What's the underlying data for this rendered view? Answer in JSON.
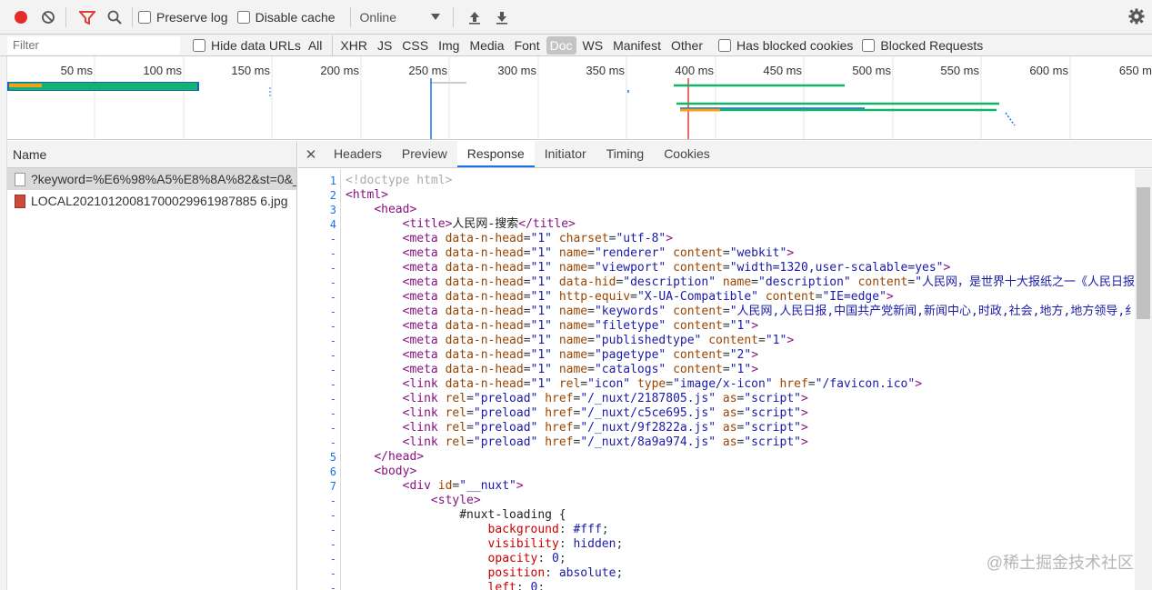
{
  "toolbar": {
    "record_icon": "record-icon",
    "clear_icon": "clear-icon",
    "filter_icon": "filter-icon",
    "search_icon": "search-icon",
    "preserve_log": "Preserve log",
    "disable_cache": "Disable cache",
    "throttle_value": "Online",
    "colors": {
      "record": "#e32d2d",
      "filter": "#e53935"
    }
  },
  "filterbar": {
    "placeholder": "Filter",
    "hide_data_urls": "Hide data URLs",
    "types": [
      "All",
      "XHR",
      "JS",
      "CSS",
      "Img",
      "Media",
      "Font",
      "Doc",
      "WS",
      "Manifest",
      "Other"
    ],
    "active_type": "Doc",
    "has_blocked_cookies": "Has blocked cookies",
    "blocked_requests": "Blocked Requests"
  },
  "overview": {
    "ticks": [
      "50 ms",
      "100 ms",
      "150 ms",
      "200 ms",
      "250 ms",
      "300 ms",
      "350 ms",
      "400 ms",
      "450 ms",
      "500 ms",
      "550 ms",
      "600 ms",
      "650 m"
    ]
  },
  "requests": {
    "header": "Name",
    "items": [
      {
        "name": "?keyword=%E6%98%A5%E8%8A%82&st=0&_...",
        "kind": "doc"
      },
      {
        "name": "LOCAL20210120081700029961987885 6.jpg",
        "kind": "img"
      }
    ]
  },
  "detail": {
    "tabs": [
      "Headers",
      "Preview",
      "Response",
      "Initiator",
      "Timing",
      "Cookies"
    ],
    "active_tab": "Response",
    "lines": [
      {
        "n": "1",
        "html": "<span class='cmt'>&lt;!doctype html&gt;</span>"
      },
      {
        "n": "2",
        "html": "<span class='tag'>&lt;html&gt;</span>"
      },
      {
        "n": "3",
        "html": "    <span class='tag'>&lt;head&gt;</span>"
      },
      {
        "n": "4",
        "html": "        <span class='tag'>&lt;title&gt;</span><span class='txt'>人民网-搜索</span><span class='tag'>&lt;/title&gt;</span>"
      },
      {
        "n": "-",
        "html": "        <span class='tag'>&lt;meta</span> <span class='attr'>data-n-head</span>=<span class='val'>\"1\"</span> <span class='attr'>charset</span>=<span class='val'>\"utf-8\"</span><span class='tag'>&gt;</span>"
      },
      {
        "n": "-",
        "html": "        <span class='tag'>&lt;meta</span> <span class='attr'>data-n-head</span>=<span class='val'>\"1\"</span> <span class='attr'>name</span>=<span class='val'>\"renderer\"</span> <span class='attr'>content</span>=<span class='val'>\"webkit\"</span><span class='tag'>&gt;</span>"
      },
      {
        "n": "-",
        "html": "        <span class='tag'>&lt;meta</span> <span class='attr'>data-n-head</span>=<span class='val'>\"1\"</span> <span class='attr'>name</span>=<span class='val'>\"viewport\"</span> <span class='attr'>content</span>=<span class='val'>\"width=1320,user-scalable=yes\"</span><span class='tag'>&gt;</span>"
      },
      {
        "n": "-",
        "html": "        <span class='tag'>&lt;meta</span> <span class='attr'>data-n-head</span>=<span class='val'>\"1\"</span> <span class='attr'>data-hid</span>=<span class='val'>\"description\"</span> <span class='attr'>name</span>=<span class='val'>\"description\"</span> <span class='attr'>content</span>=<span class='val'>\"人民网，是世界十大报纸之一《人民日报》</span>"
      },
      {
        "n": "-",
        "html": "        <span class='tag'>&lt;meta</span> <span class='attr'>data-n-head</span>=<span class='val'>\"1\"</span> <span class='attr'>http-equiv</span>=<span class='val'>\"X-UA-Compatible\"</span> <span class='attr'>content</span>=<span class='val'>\"IE=edge\"</span><span class='tag'>&gt;</span>"
      },
      {
        "n": "-",
        "html": "        <span class='tag'>&lt;meta</span> <span class='attr'>data-n-head</span>=<span class='val'>\"1\"</span> <span class='attr'>name</span>=<span class='val'>\"keywords\"</span> <span class='attr'>content</span>=<span class='val'>\"人民网,人民日报,中国共产党新闻,新闻中心,时政,社会,地方,地方领导,纟</span>"
      },
      {
        "n": "-",
        "html": "        <span class='tag'>&lt;meta</span> <span class='attr'>data-n-head</span>=<span class='val'>\"1\"</span> <span class='attr'>name</span>=<span class='val'>\"filetype\"</span> <span class='attr'>content</span>=<span class='val'>\"1\"</span><span class='tag'>&gt;</span>"
      },
      {
        "n": "-",
        "html": "        <span class='tag'>&lt;meta</span> <span class='attr'>data-n-head</span>=<span class='val'>\"1\"</span> <span class='attr'>name</span>=<span class='val'>\"publishedtype\"</span> <span class='attr'>content</span>=<span class='val'>\"1\"</span><span class='tag'>&gt;</span>"
      },
      {
        "n": "-",
        "html": "        <span class='tag'>&lt;meta</span> <span class='attr'>data-n-head</span>=<span class='val'>\"1\"</span> <span class='attr'>name</span>=<span class='val'>\"pagetype\"</span> <span class='attr'>content</span>=<span class='val'>\"2\"</span><span class='tag'>&gt;</span>"
      },
      {
        "n": "-",
        "html": "        <span class='tag'>&lt;meta</span> <span class='attr'>data-n-head</span>=<span class='val'>\"1\"</span> <span class='attr'>name</span>=<span class='val'>\"catalogs\"</span> <span class='attr'>content</span>=<span class='val'>\"1\"</span><span class='tag'>&gt;</span>"
      },
      {
        "n": "-",
        "html": "        <span class='tag'>&lt;link</span> <span class='attr'>data-n-head</span>=<span class='val'>\"1\"</span> <span class='attr'>rel</span>=<span class='val'>\"icon\"</span> <span class='attr'>type</span>=<span class='val'>\"image/x-icon\"</span> <span class='attr'>href</span>=<span class='val'>\"/favicon.ico\"</span><span class='tag'>&gt;</span>"
      },
      {
        "n": "-",
        "html": "        <span class='tag'>&lt;link</span> <span class='attr'>rel</span>=<span class='val'>\"preload\"</span> <span class='attr'>href</span>=<span class='val'>\"/_nuxt/2187805.js\"</span> <span class='attr'>as</span>=<span class='val'>\"script\"</span><span class='tag'>&gt;</span>"
      },
      {
        "n": "-",
        "html": "        <span class='tag'>&lt;link</span> <span class='attr'>rel</span>=<span class='val'>\"preload\"</span> <span class='attr'>href</span>=<span class='val'>\"/_nuxt/c5ce695.js\"</span> <span class='attr'>as</span>=<span class='val'>\"script\"</span><span class='tag'>&gt;</span>"
      },
      {
        "n": "-",
        "html": "        <span class='tag'>&lt;link</span> <span class='attr'>rel</span>=<span class='val'>\"preload\"</span> <span class='attr'>href</span>=<span class='val'>\"/_nuxt/9f2822a.js\"</span> <span class='attr'>as</span>=<span class='val'>\"script\"</span><span class='tag'>&gt;</span>"
      },
      {
        "n": "-",
        "html": "        <span class='tag'>&lt;link</span> <span class='attr'>rel</span>=<span class='val'>\"preload\"</span> <span class='attr'>href</span>=<span class='val'>\"/_nuxt/8a9a974.js\"</span> <span class='attr'>as</span>=<span class='val'>\"script\"</span><span class='tag'>&gt;</span>"
      },
      {
        "n": "5",
        "html": "    <span class='tag'>&lt;/head&gt;</span>"
      },
      {
        "n": "6",
        "html": "    <span class='tag'>&lt;body&gt;</span>"
      },
      {
        "n": "7",
        "html": "        <span class='tag'>&lt;div</span> <span class='attr'>id</span>=<span class='val'>\"__nuxt\"</span><span class='tag'>&gt;</span>"
      },
      {
        "n": "-",
        "html": "            <span class='tag'>&lt;style&gt;</span>"
      },
      {
        "n": "-",
        "html": "                <span class='txt'>#nuxt-loading {</span>"
      },
      {
        "n": "-",
        "html": "                    <span class='css-prop'>background</span>: <span class='css-val'>#fff</span>;"
      },
      {
        "n": "-",
        "html": "                    <span class='css-prop'>visibility</span>: <span class='css-val'>hidden</span>;"
      },
      {
        "n": "-",
        "html": "                    <span class='css-prop'>opacity</span>: <span class='css-val'>0</span>;"
      },
      {
        "n": "-",
        "html": "                    <span class='css-prop'>position</span>: <span class='css-val'>absolute</span>;"
      },
      {
        "n": "-",
        "html": "                    <span class='css-prop'>left</span>: <span class='css-val'>0</span>;"
      }
    ]
  },
  "watermark": "@稀土掘金技术社区"
}
